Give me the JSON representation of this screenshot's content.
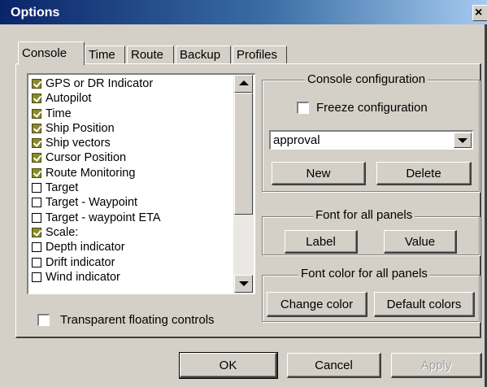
{
  "window": {
    "title": "Options",
    "close_label": "×"
  },
  "tabs": [
    {
      "label": "Console",
      "active": true
    },
    {
      "label": "Time"
    },
    {
      "label": "Route"
    },
    {
      "label": "Backup"
    },
    {
      "label": "Profiles"
    }
  ],
  "list": {
    "items": [
      {
        "label": "GPS or DR Indicator",
        "checked": true
      },
      {
        "label": "Autopilot",
        "checked": true
      },
      {
        "label": "Time",
        "checked": true
      },
      {
        "label": "Ship Position",
        "checked": true
      },
      {
        "label": "Ship vectors",
        "checked": true
      },
      {
        "label": "Cursor Position",
        "checked": true
      },
      {
        "label": "Route Monitoring",
        "checked": true
      },
      {
        "label": "Target",
        "checked": false
      },
      {
        "label": "Target - Waypoint",
        "checked": false
      },
      {
        "label": "Target - waypoint ETA",
        "checked": false
      },
      {
        "label": "Scale:",
        "checked": true
      },
      {
        "label": "Depth indicator",
        "checked": false
      },
      {
        "label": "Drift indicator",
        "checked": false
      },
      {
        "label": "Wind indicator",
        "checked": false
      }
    ]
  },
  "transparent_controls": {
    "label": "Transparent floating controls",
    "checked": false
  },
  "console_config": {
    "legend": "Console configuration",
    "freeze_label": "Freeze configuration",
    "freeze_checked": false,
    "selected": "approval",
    "new_label": "New",
    "delete_label": "Delete"
  },
  "font_panels": {
    "legend": "Font for all panels",
    "label_button": "Label",
    "value_button": "Value"
  },
  "font_color": {
    "legend": "Font color for all panels",
    "change_button": "Change color",
    "default_button": "Default colors"
  },
  "footer": {
    "ok": "OK",
    "cancel": "Cancel",
    "apply": "Apply"
  },
  "colors": {
    "title_bar": "#0a246a",
    "face": "#d4d0c8",
    "check_fill": "#8a8a2a"
  }
}
